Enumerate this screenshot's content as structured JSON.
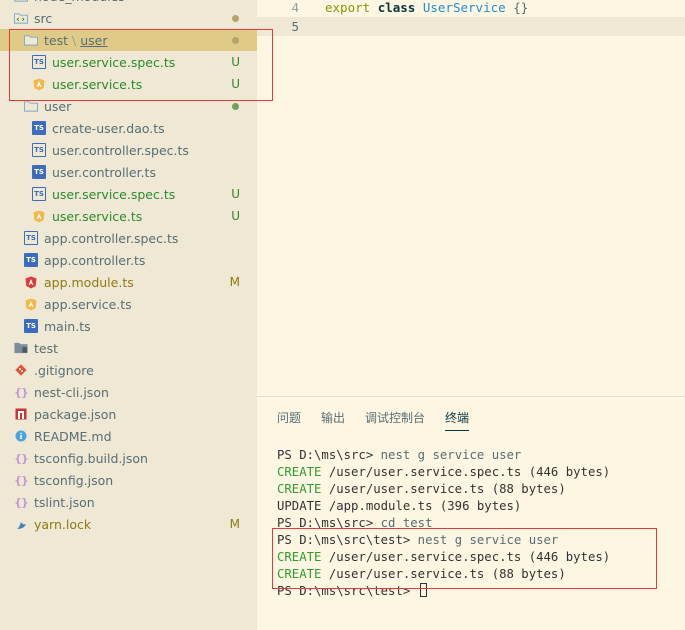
{
  "explorer": {
    "items": [
      {
        "label": "node_modules",
        "indent": 14,
        "icon": "folder-modules-icon",
        "kind": "folder",
        "color": ""
      },
      {
        "label": "src",
        "indent": 14,
        "icon": "folder-src-icon",
        "kind": "folder-src",
        "color": "",
        "dot": "olive"
      },
      {
        "label": "test",
        "sublabel": "user",
        "indent": 24,
        "icon": "folder-open-icon",
        "kind": "folder",
        "color": "",
        "dot": "olive",
        "selected": true
      },
      {
        "label": "user.service.spec.ts",
        "indent": 32,
        "icon": "ts-spec-icon",
        "kind": "spec",
        "color": "green",
        "badge": "U"
      },
      {
        "label": "user.service.ts",
        "indent": 32,
        "icon": "angular-service-icon",
        "kind": "service",
        "color": "green",
        "badge": "U"
      },
      {
        "label": "user",
        "indent": 24,
        "icon": "folder-open-icon",
        "kind": "folder",
        "color": "",
        "dot": "green"
      },
      {
        "label": "create-user.dao.ts",
        "indent": 32,
        "icon": "typescript-icon",
        "kind": "ts",
        "color": ""
      },
      {
        "label": "user.controller.spec.ts",
        "indent": 32,
        "icon": "ts-spec-icon",
        "kind": "spec",
        "color": ""
      },
      {
        "label": "user.controller.ts",
        "indent": 32,
        "icon": "typescript-icon",
        "kind": "ts",
        "color": ""
      },
      {
        "label": "user.service.spec.ts",
        "indent": 32,
        "icon": "ts-spec-icon",
        "kind": "spec",
        "color": "green",
        "badge": "U"
      },
      {
        "label": "user.service.ts",
        "indent": 32,
        "icon": "angular-service-icon",
        "kind": "service",
        "color": "green",
        "badge": "U"
      },
      {
        "label": "app.controller.spec.ts",
        "indent": 24,
        "icon": "ts-spec-icon",
        "kind": "spec",
        "color": ""
      },
      {
        "label": "app.controller.ts",
        "indent": 24,
        "icon": "typescript-icon",
        "kind": "ts",
        "color": ""
      },
      {
        "label": "app.module.ts",
        "indent": 24,
        "icon": "angular-module-icon",
        "kind": "module",
        "color": "olive",
        "badge": "M"
      },
      {
        "label": "app.service.ts",
        "indent": 24,
        "icon": "angular-service-icon",
        "kind": "service",
        "color": ""
      },
      {
        "label": "main.ts",
        "indent": 24,
        "icon": "typescript-icon",
        "kind": "ts",
        "color": ""
      },
      {
        "label": "test",
        "indent": 14,
        "icon": "folder-test-icon",
        "kind": "folder-test",
        "color": ""
      },
      {
        "label": ".gitignore",
        "indent": 14,
        "icon": "git-icon",
        "kind": "git",
        "color": ""
      },
      {
        "label": "nest-cli.json",
        "indent": 14,
        "icon": "json-icon",
        "kind": "json",
        "color": ""
      },
      {
        "label": "package.json",
        "indent": 14,
        "icon": "npm-icon",
        "kind": "npm",
        "color": ""
      },
      {
        "label": "README.md",
        "indent": 14,
        "icon": "info-icon",
        "kind": "info",
        "color": ""
      },
      {
        "label": "tsconfig.build.json",
        "indent": 14,
        "icon": "json-icon",
        "kind": "json",
        "color": ""
      },
      {
        "label": "tsconfig.json",
        "indent": 14,
        "icon": "json-icon",
        "kind": "json",
        "color": ""
      },
      {
        "label": "tslint.json",
        "indent": 14,
        "icon": "json-icon",
        "kind": "json",
        "color": ""
      },
      {
        "label": "yarn.lock",
        "indent": 14,
        "icon": "yarn-icon",
        "kind": "yarn",
        "color": "olive",
        "badge": "M"
      }
    ]
  },
  "editor": {
    "lines": [
      {
        "number": "4",
        "keyword1": "export",
        "keyword2": "class",
        "classname": "UserService",
        "brace": "{}"
      },
      {
        "number": "5"
      }
    ]
  },
  "panel": {
    "tabs": [
      "问题",
      "输出",
      "调试控制台",
      "终端"
    ],
    "active_tab": 3,
    "terminal": [
      {
        "prefix": "PS D:\\ms\\src> ",
        "cmd": "nest g service user"
      },
      {
        "tag": "CREATE",
        "text": " /user/user.service.spec.ts (446 bytes)"
      },
      {
        "tag": "CREATE",
        "text": " /user/user.service.ts (88 bytes)"
      },
      {
        "plain": "UPDATE /app.module.ts (396 bytes)"
      },
      {
        "prefix": "PS D:\\ms\\src> ",
        "cmd": "cd test"
      },
      {
        "prefix": "PS D:\\ms\\src\\test> ",
        "cmd": "nest g service user"
      },
      {
        "tag": "CREATE",
        "text": " /user/user.service.spec.ts (446 bytes)"
      },
      {
        "tag": "CREATE",
        "text": " /user/user.service.ts (88 bytes)"
      },
      {
        "prefix": "PS D:\\ms\\src\\test> ",
        "cursor": true
      }
    ]
  }
}
